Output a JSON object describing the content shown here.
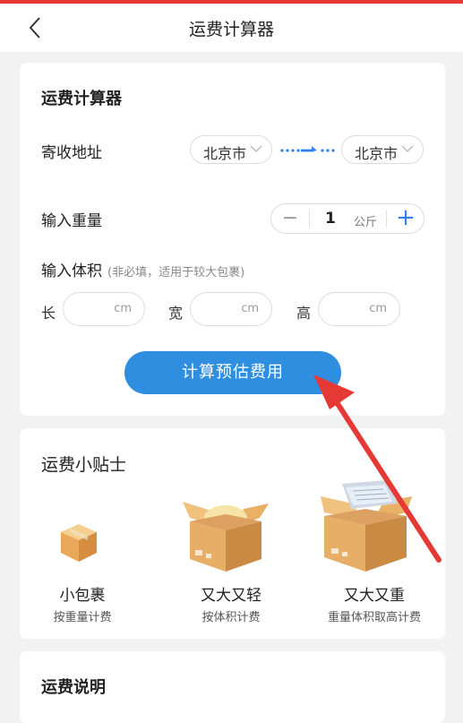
{
  "nav": {
    "title": "运费计算器"
  },
  "calculator": {
    "title": "运费计算器",
    "address_label": "寄收地址",
    "from_city": "北京市",
    "to_city": "北京市",
    "weight_label": "输入重量",
    "weight_value": "1",
    "weight_unit": "公斤",
    "volume_label": "输入体积",
    "volume_hint": "(非必填，适用于较大包裹)",
    "length_label": "长",
    "width_label": "宽",
    "height_label": "高",
    "unit_cm": "cm",
    "calc_button": "计算预估费用"
  },
  "tips": {
    "title": "运费小贴士",
    "items": [
      {
        "name": "小包裹",
        "desc": "按重量计费"
      },
      {
        "name": "又大又轻",
        "desc": "按体积计费"
      },
      {
        "name": "又大又重",
        "desc": "重量体积取高计费"
      }
    ]
  },
  "explanation": {
    "title": "运费说明"
  },
  "colors": {
    "accent": "#2f8ee0",
    "arrow": "#e53935",
    "top_bar": "#e53935"
  }
}
